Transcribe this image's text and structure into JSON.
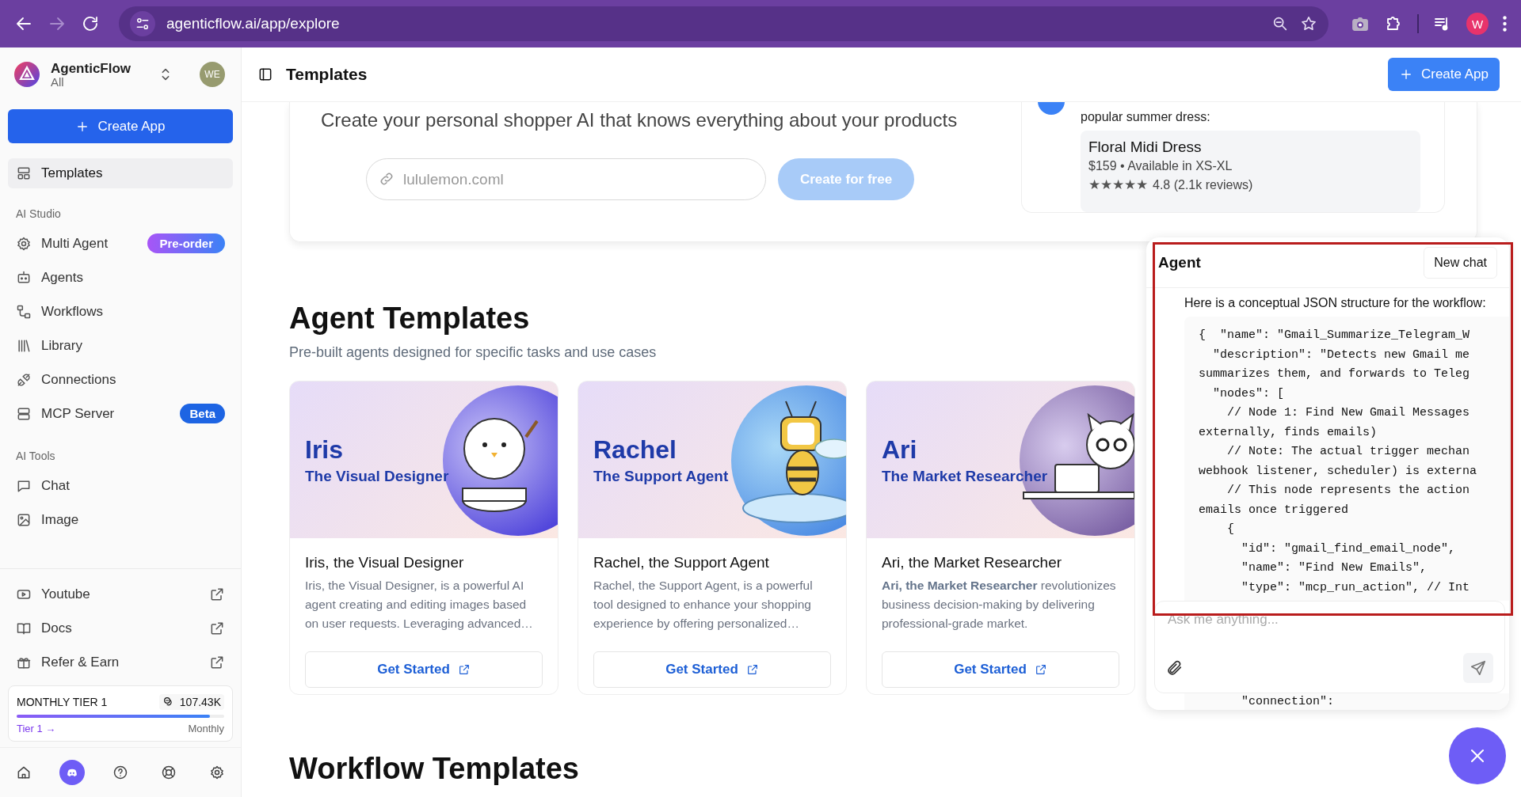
{
  "browser": {
    "url": "agenticflow.ai/app/explore",
    "profile": "W"
  },
  "sidebar": {
    "brand": "AgenticFlow",
    "workspace": "All",
    "avatar": "WE",
    "create_button": "Create App",
    "sections": [
      {
        "items": [
          {
            "label": "Templates",
            "selected": true
          }
        ]
      },
      {
        "title": "AI Studio",
        "items": [
          {
            "label": "Multi Agent",
            "selected": false,
            "badge": {
              "text": "Pre-order",
              "kind": "gradient"
            }
          },
          {
            "label": "Agents",
            "selected": false
          },
          {
            "label": "Workflows",
            "selected": false
          },
          {
            "label": "Library",
            "selected": false
          },
          {
            "label": "Connections",
            "selected": false
          },
          {
            "label": "MCP Server",
            "selected": false,
            "badge": {
              "text": "Beta",
              "kind": "solid"
            }
          }
        ]
      },
      {
        "title": "AI Tools",
        "items": [
          {
            "label": "Chat",
            "selected": false
          },
          {
            "label": "Image",
            "selected": false
          }
        ]
      },
      {
        "items": [
          {
            "label": "Youtube",
            "selected": false,
            "external": true
          },
          {
            "label": "Docs",
            "selected": false,
            "external": true
          },
          {
            "label": "Refer & Earn",
            "selected": false,
            "external": true
          }
        ]
      }
    ],
    "tier": {
      "title": "MONTHLY TIER 1",
      "credits": "107.43K",
      "level": 0.93,
      "link": "Tier 1 →",
      "period": "Monthly"
    },
    "bottom_icons": [
      {
        "selected": false
      },
      {
        "selected": true
      },
      {
        "selected": false
      },
      {
        "selected": false
      },
      {
        "selected": false
      }
    ]
  },
  "header": {
    "title": "Templates",
    "button": "Create App"
  },
  "hero": {
    "tagline": "Create your personal shopper AI that knows everything about your products",
    "url_field": {
      "placeholder": "lululemon.coml"
    },
    "button": {
      "label": "Create for free",
      "disabled": true
    },
    "preview": {
      "message": "popular summer dress:",
      "product": {
        "name": "Floral Midi Dress",
        "details": "$159 • Available in XS-XL",
        "stars": 5,
        "rating": "4.8 (2.1k reviews)"
      }
    }
  },
  "agent_templates": {
    "title": "Agent Templates",
    "subtitle": "Pre-built agents designed for specific tasks and use cases",
    "cards": [
      {
        "name": "Iris",
        "role": "The Visual Designer",
        "title": "Iris, the Visual Designer",
        "description": "Iris, the Visual Designer, is a powerful AI agent creating and editing images based on user requests. Leveraging advanced…",
        "button": "Get Started"
      },
      {
        "name": "Rachel",
        "role": "The Support Agent",
        "title": "Rachel, the Support Agent",
        "description": "Rachel, the Support Agent, is a powerful tool designed to enhance your shopping experience by offering personalized…",
        "button": "Get Started"
      },
      {
        "name": "Ari",
        "role": "The Market Researcher",
        "title": "Ari, the Market Researcher",
        "description": "**Ari, the Market Researcher** revolutionizes business decision-making by delivering professional-grade market.",
        "button": "Get Started"
      }
    ]
  },
  "workflow_templates": {
    "title": "Workflow Templates"
  },
  "chat": {
    "title": "Agent",
    "new_chat": "New chat",
    "intro": "Here is a conceptual JSON structure for the workflow:",
    "code_lines": [
      "{  \"name\": \"Gmail_Summarize_Telegram_W",
      "  \"description\": \"Detects new Gmail me",
      "summarizes them, and forwards to Teleg",
      "  \"nodes\": [",
      "    // Node 1: Find New Gmail Messages",
      "externally, finds emails)",
      "    // Note: The actual trigger mechan",
      "webhook listener, scheduler) is externa",
      "    // This node represents the action",
      "emails once triggered",
      "    {",
      "      \"id\": \"gmail_find_email_node\",",
      "      \"name\": \"Find New Emails\",",
      "      \"type\": \"mcp_run_action\", // Int"
    ],
    "input": {
      "placeholder": "Ask me anything..."
    },
    "code_below": "      \"connection\":"
  }
}
